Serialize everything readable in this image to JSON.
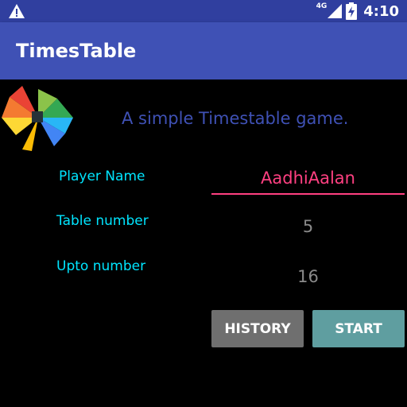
{
  "status_bar": {
    "time": "4:10",
    "network_label": "4G",
    "icons": [
      "warning-icon",
      "signal-icon",
      "battery-charging-icon"
    ]
  },
  "app_bar": {
    "title": "TimesTable"
  },
  "header": {
    "tagline": "A simple Timestable game."
  },
  "form": {
    "player_name_label": "Player Name",
    "player_name_value": "AadhiAalan",
    "table_number_label": "Table number",
    "table_number_value": "5",
    "upto_number_label": "Upto number",
    "upto_number_value": "16"
  },
  "buttons": {
    "history_label": "HISTORY",
    "start_label": "START"
  },
  "colors": {
    "primary": "#3f51b5",
    "primary_dark": "#303f9f",
    "accent": "#ff4081",
    "label_cyan": "#00e5ff",
    "history_button": "#6f6f6f",
    "start_button": "#5f9ea0"
  }
}
